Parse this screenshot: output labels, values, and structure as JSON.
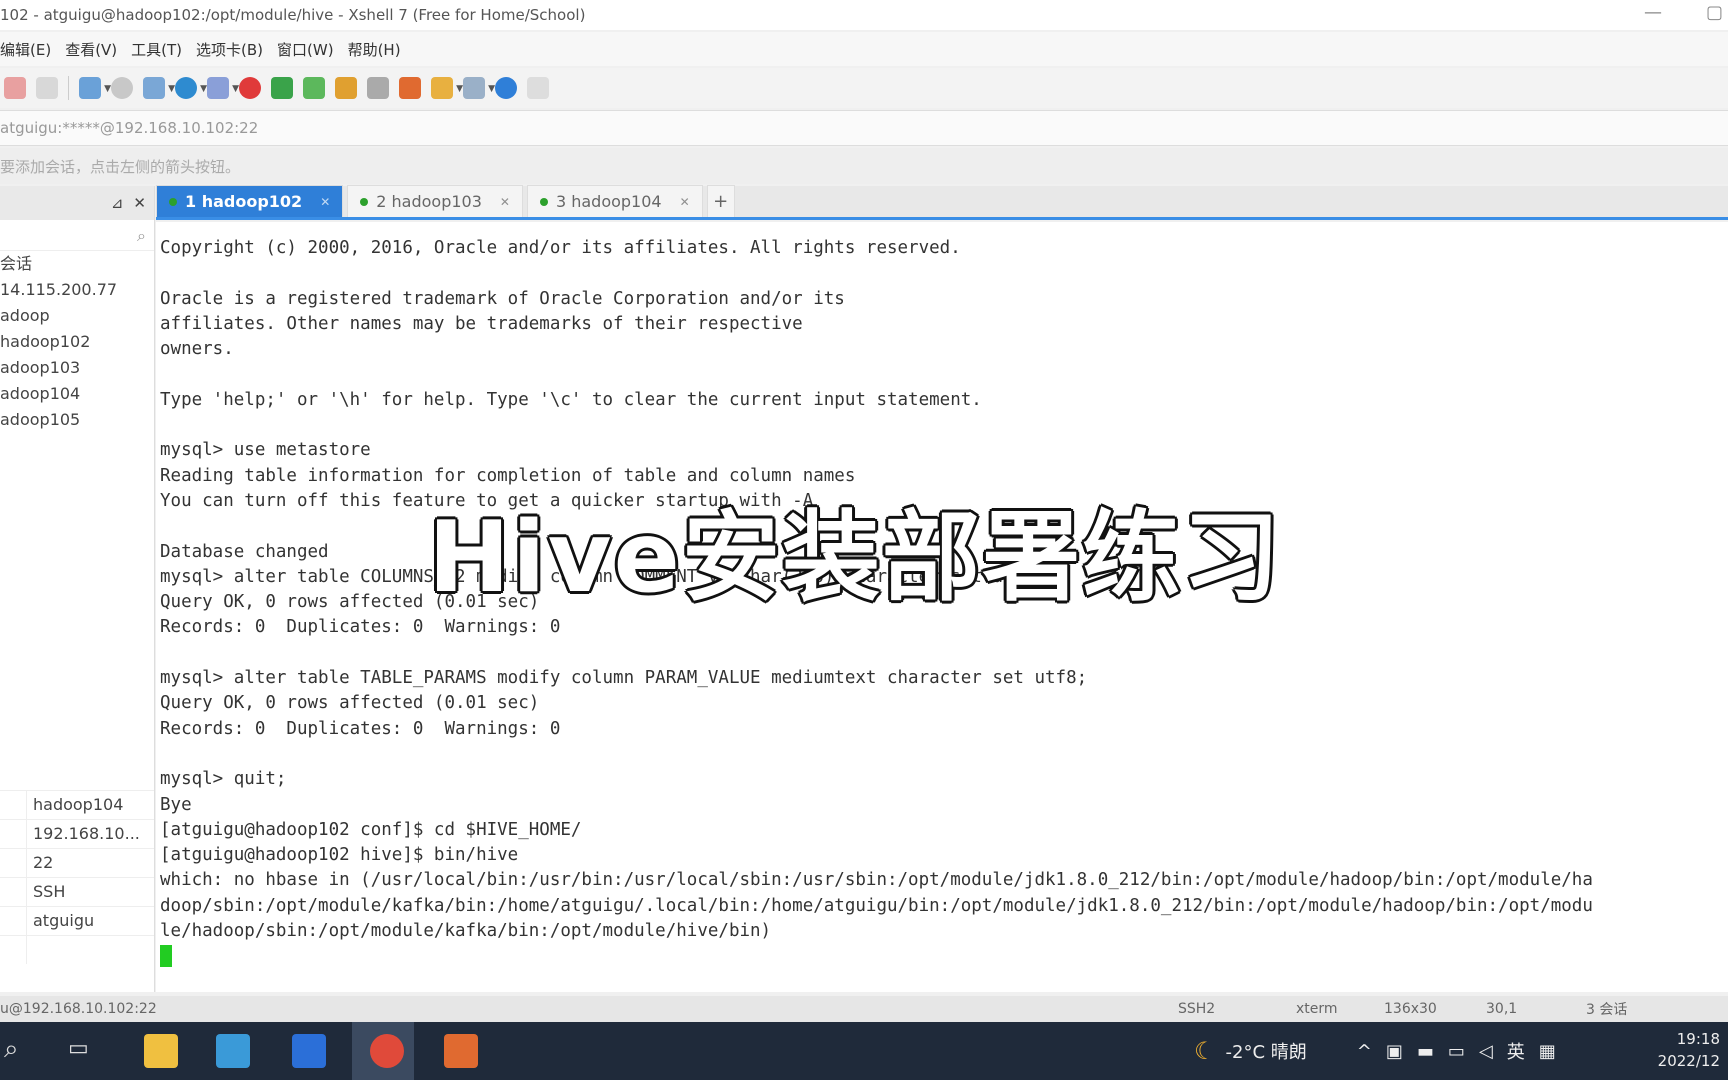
{
  "window": {
    "title": "102 - atguigu@hadoop102:/opt/module/hive - Xshell 7 (Free for Home/School)"
  },
  "menu": [
    "编辑(E)",
    "查看(V)",
    "工具(T)",
    "选项卡(B)",
    "窗口(W)",
    "帮助(H)"
  ],
  "address": "atguigu:*****@192.168.10.102:22",
  "hint": "要添加会话，点击左侧的箭头按钮。",
  "sidebar": {
    "tree": [
      "会话",
      "14.115.200.77",
      "adoop",
      "hadoop102",
      "adoop103",
      "adoop104",
      "adoop105"
    ],
    "props": [
      "hadoop104",
      "192.168.10...",
      "22",
      "SSH",
      "atguigu",
      ""
    ]
  },
  "tabs": [
    {
      "label": "1 hadoop102",
      "active": true
    },
    {
      "label": "2 hadoop103",
      "active": false
    },
    {
      "label": "3 hadoop104",
      "active": false
    }
  ],
  "terminal": {
    "lines": [
      "Copyright (c) 2000, 2016, Oracle and/or its affiliates. All rights reserved.",
      "",
      "Oracle is a registered trademark of Oracle Corporation and/or its",
      "affiliates. Other names may be trademarks of their respective",
      "owners.",
      "",
      "Type 'help;' or '\\h' for help. Type '\\c' to clear the current input statement.",
      "",
      "mysql> use metastore",
      "Reading table information for completion of table and column names",
      "You can turn off this feature to get a quicker startup with -A",
      "",
      "Database changed",
      "mysql> alter table COLUMNS_V2 modify column COMMENT varchar(256) character set utf8;",
      "Query OK, 0 rows affected (0.01 sec)",
      "Records: 0  Duplicates: 0  Warnings: 0",
      "",
      "mysql> alter table TABLE_PARAMS modify column PARAM_VALUE mediumtext character set utf8;",
      "Query OK, 0 rows affected (0.01 sec)",
      "Records: 0  Duplicates: 0  Warnings: 0",
      "",
      "mysql> quit;",
      "Bye",
      "[atguigu@hadoop102 conf]$ cd $HIVE_HOME/",
      "[atguigu@hadoop102 hive]$ bin/hive",
      "which: no hbase in (/usr/local/bin:/usr/bin:/usr/local/sbin:/usr/sbin:/opt/module/jdk1.8.0_212/bin:/opt/module/hadoop/bin:/opt/module/ha",
      "doop/sbin:/opt/module/kafka/bin:/home/atguigu/.local/bin:/home/atguigu/bin:/opt/module/jdk1.8.0_212/bin:/opt/module/hadoop/bin:/opt/modu",
      "le/hadoop/sbin:/opt/module/kafka/bin:/opt/module/hive/bin)"
    ]
  },
  "overlay": "Hive安装部署练习",
  "status": {
    "left": "u@192.168.10.102:22",
    "proto": "SSH2",
    "term": "xterm",
    "size": "136x30",
    "pos": "30,1",
    "sessions": "3 会话"
  },
  "tray": {
    "weather": "-2°C 晴朗",
    "lang": "英",
    "time": "19:18",
    "date": "2022/12"
  },
  "colors": {
    "accent": "#2f7fd8",
    "cursor": "#22cc22",
    "taskbar": "#1f2a3a"
  }
}
